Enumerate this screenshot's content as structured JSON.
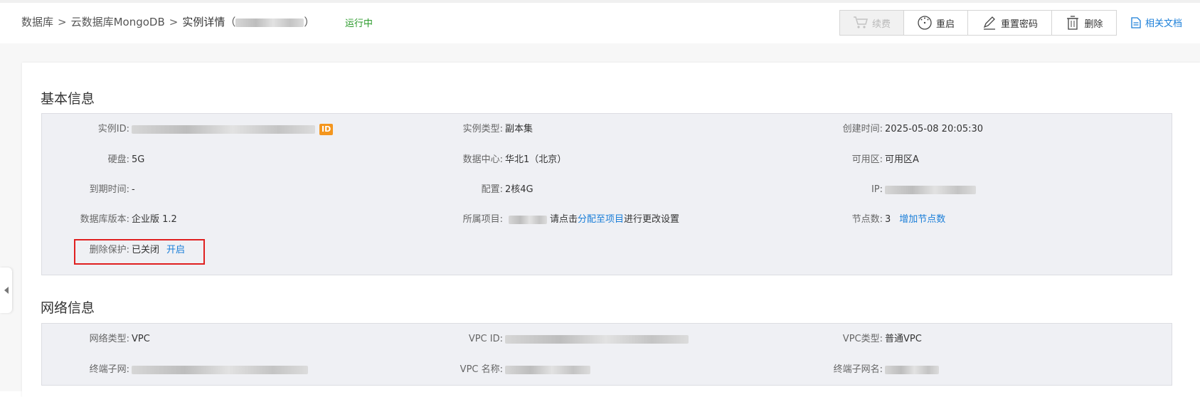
{
  "breadcrumb": {
    "items": [
      "数据库",
      "云数据库MongoDB",
      "实例详情"
    ],
    "separator": ">",
    "paren_open": "（",
    "paren_close": "）"
  },
  "status": "运行中",
  "toolbar": {
    "renew": "续费",
    "restart": "重启",
    "reset_password": "重置密码",
    "delete": "删除",
    "docs": "相关文档"
  },
  "basic_info": {
    "title": "基本信息",
    "instance_id_label": "实例ID:",
    "id_badge": "ID",
    "instance_type_label": "实例类型:",
    "instance_type": "副本集",
    "created_label": "创建时间:",
    "created": "2025-05-08 20:05:30",
    "disk_label": "硬盘:",
    "disk": "5G",
    "datacenter_label": "数据中心:",
    "datacenter": "华北1（北京）",
    "zone_label": "可用区:",
    "zone": "可用区A",
    "expire_label": "到期时间:",
    "expire": "-",
    "config_label": "配置:",
    "config": "2核4G",
    "ip_label": "IP:",
    "version_label": "数据库版本:",
    "version": "企业版 1.2",
    "project_label": "所属项目:",
    "project_hint_pre": "请点击",
    "project_link": "分配至项目",
    "project_hint_post": "进行更改设置",
    "nodes_label": "节点数:",
    "nodes": "3",
    "add_nodes": "增加节点数",
    "delete_protect_label": "删除保护:",
    "delete_protect": "已关闭",
    "delete_protect_action": "开启"
  },
  "network_info": {
    "title": "网络信息",
    "net_type_label": "网络类型:",
    "net_type": "VPC",
    "vpc_id_label": "VPC ID:",
    "vpc_type_label": "VPC类型:",
    "vpc_type": "普通VPC",
    "subnet_label": "终端子网:",
    "vpc_name_label": "VPC 名称:",
    "subnet_name_label": "终端子网名:"
  },
  "colors": {
    "accent": "#1a7ed8",
    "status_running": "#2a9a2a",
    "highlight": "#e02020",
    "badge": "#f4961e"
  },
  "icons": {
    "renew": "cart-icon",
    "restart": "restart-icon",
    "reset_password": "pencil-icon",
    "delete": "trash-icon",
    "docs": "document-icon",
    "side_toggle": "caret-left-icon"
  }
}
